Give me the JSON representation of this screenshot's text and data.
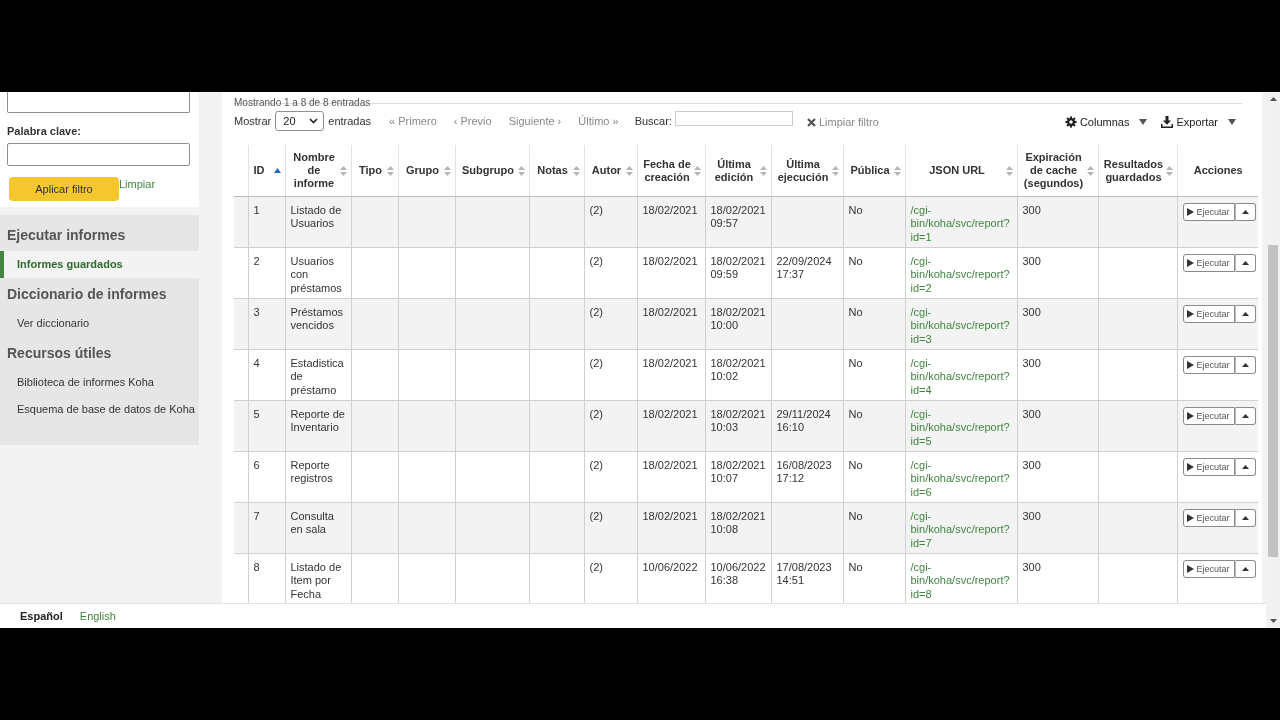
{
  "sidebar": {
    "filter": {
      "fields": [
        {
          "kind": "input"
        },
        {
          "kind": "label",
          "text": "Palabra clave:"
        },
        {
          "kind": "input"
        }
      ],
      "apply_button": "Aplicar filtro",
      "clear_link": "Limpiar"
    },
    "sections": [
      {
        "heading": "Ejecutar informes",
        "items": [
          {
            "label": "Informes guardados",
            "selected": true
          }
        ]
      },
      {
        "heading": "Diccionario de informes",
        "items": [
          {
            "label": "Ver diccionario",
            "selected": false
          }
        ]
      },
      {
        "heading": "Recursos útiles",
        "items": [
          {
            "label": "Biblioteca de informes Koha",
            "selected": false
          },
          {
            "label": "Esquema de base de datos de Koha",
            "selected": false
          }
        ]
      }
    ]
  },
  "toolbar": {
    "info": "Mostrando 1 a 8 de 8 entradas",
    "show_label": "Mostrar",
    "page_size": "20",
    "entries_label": "entradas",
    "paging": [
      {
        "label": "« Primero",
        "disabled": true
      },
      {
        "label": "‹ Previo",
        "disabled": true
      },
      {
        "label": "Siguiente ›",
        "disabled": true
      },
      {
        "label": "Último »",
        "disabled": true
      }
    ],
    "search_label": "Buscar:",
    "clear_filter": {
      "label": "Limpiar filtro",
      "disabled": true
    },
    "columns_button": "Columnas",
    "export_button": "Exportar"
  },
  "table": {
    "columns": [
      {
        "label": "ID",
        "sortable": true,
        "sorted": true
      },
      {
        "label": "Nombre de informe",
        "sortable": true,
        "sorted": false
      },
      {
        "label": "Tipo",
        "sortable": true,
        "sorted": false
      },
      {
        "label": "Grupo",
        "sortable": true,
        "sorted": false
      },
      {
        "label": "Subgrupo",
        "sortable": true,
        "sorted": false
      },
      {
        "label": "Notas",
        "sortable": true,
        "sorted": false
      },
      {
        "label": "Autor",
        "sortable": true,
        "sorted": false
      },
      {
        "label": "Fecha de creación",
        "sortable": true,
        "sorted": false
      },
      {
        "label": "Última edición",
        "sortable": true,
        "sorted": false
      },
      {
        "label": "Última ejecución",
        "sortable": true,
        "sorted": false
      },
      {
        "label": "Pública",
        "sortable": true,
        "sorted": false
      },
      {
        "label": "JSON URL",
        "sortable": true,
        "sorted": false
      },
      {
        "label": "Expiración de cache (segundos)",
        "sortable": true,
        "sorted": false
      },
      {
        "label": "Resultados guardados",
        "sortable": true,
        "sorted": false
      },
      {
        "label": "Acciones",
        "sortable": false,
        "sorted": false
      }
    ],
    "rows": [
      {
        "id": "1",
        "nombre": "Listado de Usuarios",
        "autor": "(2)",
        "fecha_creacion": "18/02/2021",
        "ultima_edicion": "18/02/2021 09:57",
        "publica": "No",
        "json_url": "/cgi-bin/koha/svc/report?id=1",
        "expiracion_cache": "300",
        "action": "Ejecutar"
      },
      {
        "id": "2",
        "nombre": "Usuarios con préstamos",
        "autor": "(2)",
        "fecha_creacion": "18/02/2021",
        "ultima_edicion": "18/02/2021 09:59",
        "ultima_ejecucion": "22/09/2024 17:37",
        "publica": "No",
        "json_url": "/cgi-bin/koha/svc/report?id=2",
        "expiracion_cache": "300",
        "action": "Ejecutar"
      },
      {
        "id": "3",
        "nombre": "Préstamos vencidos",
        "autor": "(2)",
        "fecha_creacion": "18/02/2021",
        "ultima_edicion": "18/02/2021 10:00",
        "publica": "No",
        "json_url": "/cgi-bin/koha/svc/report?id=3",
        "expiracion_cache": "300",
        "action": "Ejecutar"
      },
      {
        "id": "4",
        "nombre": "Estadistica de préstamo",
        "autor": "(2)",
        "fecha_creacion": "18/02/2021",
        "ultima_edicion": "18/02/2021 10:02",
        "publica": "No",
        "json_url": "/cgi-bin/koha/svc/report?id=4",
        "expiracion_cache": "300",
        "action": "Ejecutar"
      },
      {
        "id": "5",
        "nombre": "Reporte de Inventario",
        "autor": "(2)",
        "fecha_creacion": "18/02/2021",
        "ultima_edicion": "18/02/2021 10:03",
        "ultima_ejecucion": "29/11/2024 16:10",
        "publica": "No",
        "json_url": "/cgi-bin/koha/svc/report?id=5",
        "expiracion_cache": "300",
        "action": "Ejecutar"
      },
      {
        "id": "6",
        "nombre": "Reporte registros",
        "autor": "(2)",
        "fecha_creacion": "18/02/2021",
        "ultima_edicion": "18/02/2021 10:07",
        "ultima_ejecucion": "16/08/2023 17:12",
        "publica": "No",
        "json_url": "/cgi-bin/koha/svc/report?id=6",
        "expiracion_cache": "300",
        "action": "Ejecutar"
      },
      {
        "id": "7",
        "nombre": "Consulta en sala",
        "autor": "(2)",
        "fecha_creacion": "18/02/2021",
        "ultima_edicion": "18/02/2021 10:08",
        "publica": "No",
        "json_url": "/cgi-bin/koha/svc/report?id=7",
        "expiracion_cache": "300",
        "action": "Ejecutar"
      },
      {
        "id": "8",
        "nombre": "Listado de Item por Fecha",
        "autor": "(2)",
        "fecha_creacion": "10/06/2022",
        "ultima_edicion": "10/06/2022 16:38",
        "ultima_ejecucion": "17/08/2023 14:51",
        "publica": "No",
        "json_url": "/cgi-bin/koha/svc/report?id=8",
        "expiracion_cache": "300",
        "action": "Ejecutar"
      }
    ]
  },
  "footer": {
    "languages": [
      {
        "label": "Español",
        "selected": true
      },
      {
        "label": "English",
        "selected": false
      }
    ]
  }
}
